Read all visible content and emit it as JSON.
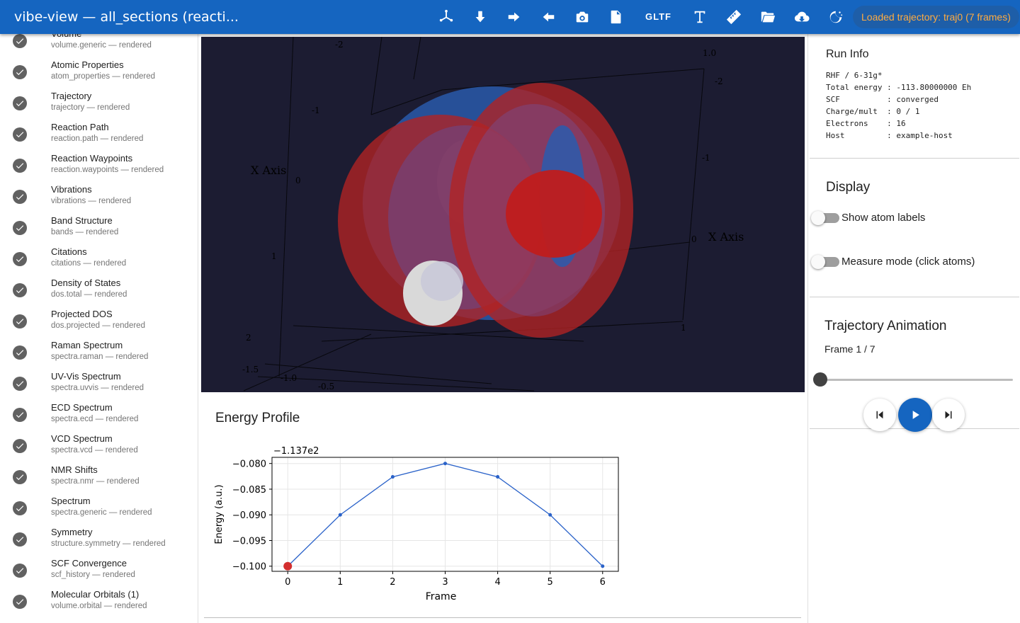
{
  "header": {
    "title": "vibe-view — all_sections (reacti...",
    "gltf_label": "GLTF",
    "status": "Loaded trajectory: traj0 (7 frames)",
    "icons": [
      "axes-icon",
      "arrow-down-icon",
      "arrow-right-icon",
      "arrow-left-icon",
      "camera-icon",
      "file-export-icon",
      "text-icon",
      "ruler-icon",
      "folder-open-icon",
      "cloud-download-icon",
      "theme-toggle-icon"
    ]
  },
  "sidebar": {
    "items": [
      {
        "title": "Volume",
        "sub": "volume.generic — rendered"
      },
      {
        "title": "Atomic Properties",
        "sub": "atom_properties — rendered"
      },
      {
        "title": "Trajectory",
        "sub": "trajectory — rendered"
      },
      {
        "title": "Reaction Path",
        "sub": "reaction.path — rendered"
      },
      {
        "title": "Reaction Waypoints",
        "sub": "reaction.waypoints — rendered"
      },
      {
        "title": "Vibrations",
        "sub": "vibrations — rendered"
      },
      {
        "title": "Band Structure",
        "sub": "bands — rendered"
      },
      {
        "title": "Citations",
        "sub": "citations — rendered"
      },
      {
        "title": "Density of States",
        "sub": "dos.total — rendered"
      },
      {
        "title": "Projected DOS",
        "sub": "dos.projected — rendered"
      },
      {
        "title": "Raman Spectrum",
        "sub": "spectra.raman — rendered"
      },
      {
        "title": "UV-Vis Spectrum",
        "sub": "spectra.uvvis — rendered"
      },
      {
        "title": "ECD Spectrum",
        "sub": "spectra.ecd — rendered"
      },
      {
        "title": "VCD Spectrum",
        "sub": "spectra.vcd — rendered"
      },
      {
        "title": "NMR Shifts",
        "sub": "spectra.nmr — rendered"
      },
      {
        "title": "Spectrum",
        "sub": "spectra.generic — rendered"
      },
      {
        "title": "Symmetry",
        "sub": "structure.symmetry — rendered"
      },
      {
        "title": "SCF Convergence",
        "sub": "scf_history — rendered"
      },
      {
        "title": "Molecular Orbitals (1)",
        "sub": "volume.orbital — rendered"
      }
    ]
  },
  "viewer": {
    "axis_title_left": "X Axis",
    "axis_title_right": "X Axis",
    "ticks_top": [
      "-2",
      "-1",
      "0",
      "1",
      "2"
    ],
    "ticks_bottom": [
      "-1.5",
      "-1.0",
      "-0.5"
    ],
    "ticks_right": [
      "1.0",
      "-2",
      "-1",
      "0",
      "1"
    ],
    "colors": {
      "background": "#1c1c32",
      "positive_lobe": "#b22222",
      "negative_lobe": "#2a5cae",
      "atom": "#d9d9d9"
    }
  },
  "energy": {
    "title": "Energy Profile",
    "chart_data": {
      "type": "line",
      "offset_label": "−1.137e2",
      "xlabel": "Frame",
      "ylabel": "Energy (a.u.)",
      "x": [
        0,
        1,
        2,
        3,
        4,
        5,
        6
      ],
      "y": [
        -0.1,
        -0.09,
        -0.0826,
        -0.08,
        -0.0826,
        -0.09,
        -0.1
      ],
      "xlim": [
        -0.3,
        6.3
      ],
      "ylim": [
        -0.101,
        -0.0788
      ],
      "xticks": [
        "0",
        "1",
        "2",
        "3",
        "4",
        "5",
        "6"
      ],
      "yticks": [
        -0.08,
        -0.085,
        -0.09,
        -0.095,
        -0.1
      ],
      "ytick_labels": [
        "−0.080",
        "−0.085",
        "−0.090",
        "−0.095",
        "−0.100"
      ],
      "highlight_index": 0,
      "grid": true,
      "line_color": "#2a62c9",
      "highlight_color": "#d32f2f"
    }
  },
  "run_info": {
    "title": "Run Info",
    "text": "RHF / 6-31g*\nTotal energy : -113.80000000 Eh\nSCF          : converged\nCharge/mult  : 0 / 1\nElectrons    : 16\nHost         : example-host"
  },
  "display": {
    "title": "Display",
    "toggles": [
      {
        "label": "Show atom labels",
        "on": false
      },
      {
        "label": "Measure mode (click atoms)",
        "on": false
      }
    ]
  },
  "trajectory": {
    "title": "Trajectory Animation",
    "frame_label": "Frame 1 / 7",
    "frame_current": 1,
    "frame_total": 7
  }
}
